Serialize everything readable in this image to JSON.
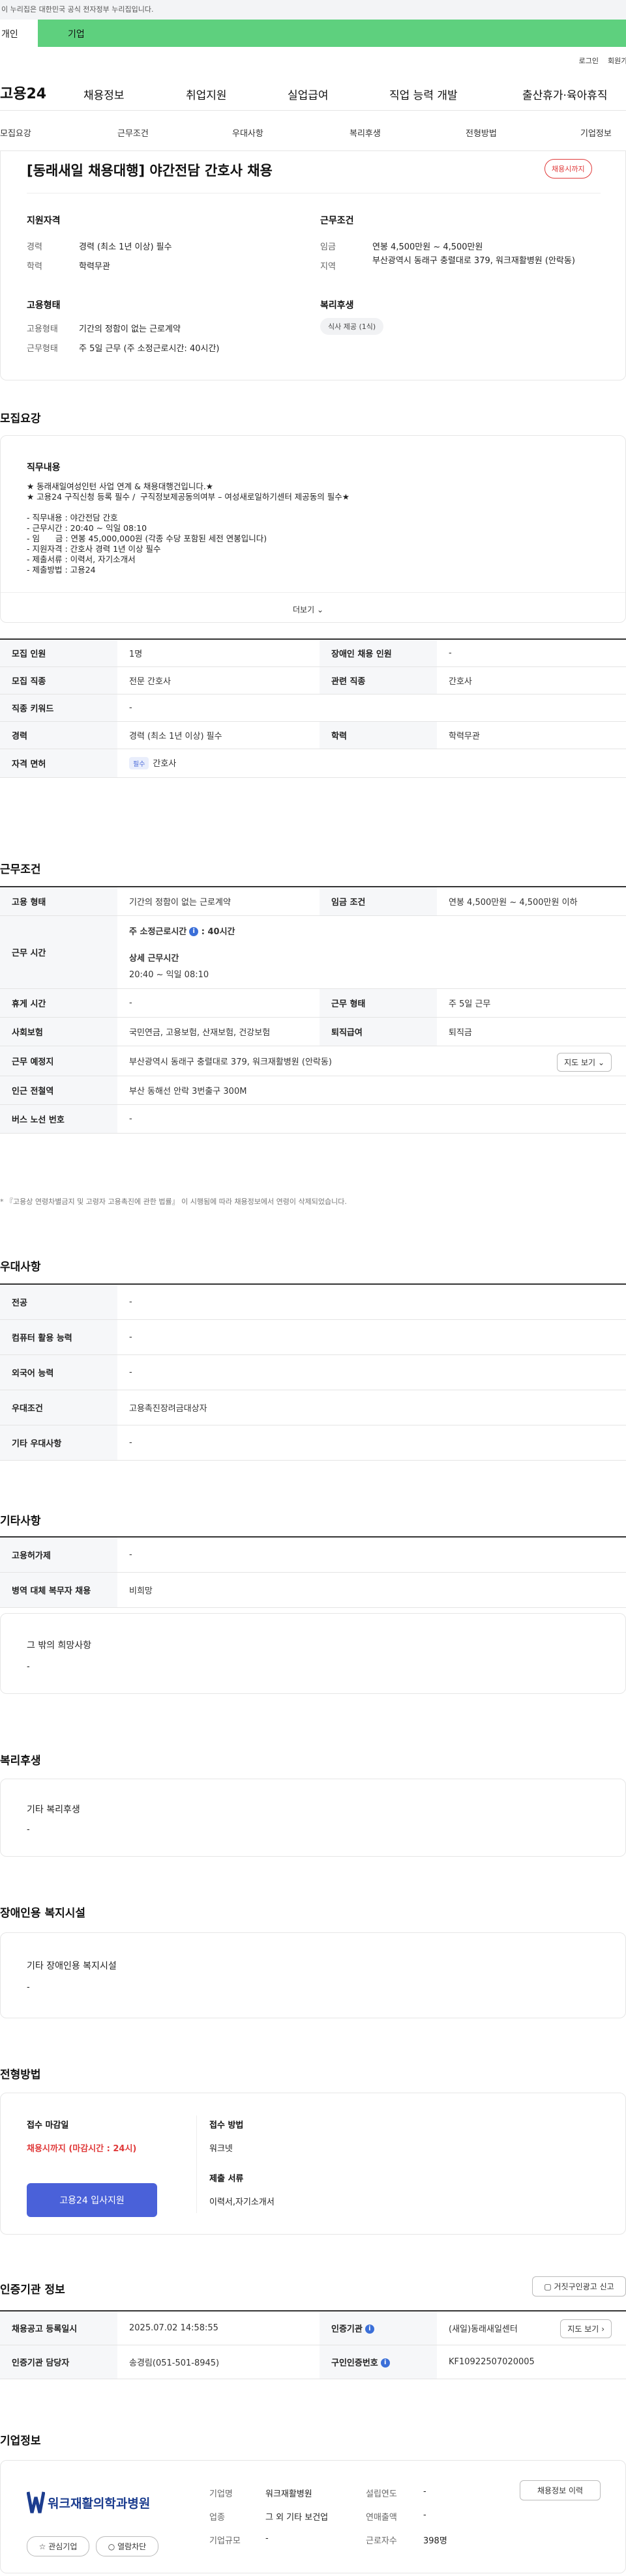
{
  "gov_banner": "이 누리집은 대한민국 공식 전자정부 누리집입니다.",
  "tabs": {
    "person": "개인",
    "business": "기업"
  },
  "util": {
    "login": "로그인",
    "join": "회원가입"
  },
  "logo": "고용24",
  "gnb": [
    "채용정보",
    "취업지원",
    "실업급여",
    "직업 능력 개발",
    "출산휴가·육아휴직"
  ],
  "subnav": [
    "모집요강",
    "근무조건",
    "우대사항",
    "복리후생",
    "전형방법",
    "기업정보"
  ],
  "summary": {
    "title": "[동래새일 채용대행] 야간전담 간호사 채용",
    "badge": "채용시까지",
    "qual_h": "지원자격",
    "career_l": "경력",
    "career_v": "경력 (최소 1년 이상) 필수",
    "edu_l": "학력",
    "edu_v": "학력무관",
    "emp_h": "고용형태",
    "type_l": "고용형태",
    "type_v": "기간의 정함이 없는 근로계약",
    "work_l": "근무형태",
    "work_v": "주 5일 근무 (주 소정근로시간: 40시간)",
    "cond_h": "근무조건",
    "wage_l": "임금",
    "wage_v": "연봉 4,500만원 ~ 4,500만원",
    "region_l": "지역",
    "region_v": "부산광역시 동래구 충렬대로 379, 워크재활병원 (안락동)",
    "welfare_h": "복리후생",
    "welfare_tag": "식사 제공 (1식)"
  },
  "recruit": {
    "heading": "모집요강",
    "duty_h": "직무내용",
    "lines": [
      "★ 동래새일여성인턴 사업 연계 & 채용대행건입니다.★",
      "★ 고용24 구직신청 등록 필수 /  구직정보제공동의여부 – 여성새로일하기센터 제공동의 필수★",
      "",
      "- 직무내용 : 야간전담 간호",
      "- 근무시간 : 20:40 ~ 익일 08:10",
      "- 임      금 : 연봉 45,000,000원 (각종 수당 포함된 세전 연봉입니다)",
      "- 지원자격 : 간호사 경력 1년 이상 필수",
      "- 제출서류 : 이력서, 자기소개서",
      "- 제출방법 : 고용24"
    ],
    "more": "더보기",
    "rows": [
      [
        "모집 인원",
        "1명",
        "장애인 채용 인원",
        "-"
      ],
      [
        "모집 직종",
        "전문 간호사",
        "관련 직종",
        "간호사"
      ],
      [
        "직종 키워드",
        "-",
        "",
        ""
      ],
      [
        "경력",
        "경력 (최소 1년 이상) 필수",
        "학력",
        "학력무관"
      ],
      [
        "자격 면허",
        "간호사",
        "",
        ""
      ]
    ],
    "pill": "필수"
  },
  "conditions": {
    "heading": "근무조건",
    "type_l": "고용 형태",
    "type_v": "기간의 정함이 없는 근로계약",
    "wage_l": "임금 조건",
    "wage_v": "연봉 4,500만원 ~ 4,500만원 이하",
    "time_l": "근무 시간",
    "time_main": "주 소정근로시간",
    "time_hours": ": 40시간",
    "time_detail_l": "상세 근무시간",
    "time_detail_v": "20:40 ~ 익일 08:10",
    "rest_l": "휴게 시간",
    "rest_v": "-",
    "form_l": "근무 형태",
    "form_v": "주 5일 근무",
    "ins_l": "사회보험",
    "ins_v": "국민연금, 고용보험, 산재보험, 건강보험",
    "sev_l": "퇴직급여",
    "sev_v": "퇴직금",
    "place_l": "근무 예정지",
    "place_v": "부산광역시 동래구 충렬대로 379, 워크재활병원 (안락동)",
    "map_btn": "지도 보기",
    "subway_l": "인근 전철역",
    "subway_v": "부산 동해선 안락 3번출구 300M",
    "bus_l": "버스 노선 번호",
    "bus_v": "-",
    "note": "* 『고용상 연령차별금지 및 고령자 고용촉진에 관한 법률』 이 시행됨에 따라 채용정보에서 연령이 삭제되었습니다."
  },
  "pref": {
    "heading": "우대사항",
    "rows": [
      [
        "전공",
        "-"
      ],
      [
        "컴퓨터 활용 능력",
        "-"
      ],
      [
        "외국어 능력",
        "-"
      ],
      [
        "우대조건",
        "고용촉진장려금대상자"
      ],
      [
        "기타 우대사항",
        "-"
      ]
    ]
  },
  "etc": {
    "heading": "기타사항",
    "rows": [
      [
        "고용허가제",
        "-"
      ],
      [
        "병역 대체 복무자 채용",
        "비희망"
      ]
    ],
    "box_h": "그 밖의 희망사항",
    "box_v": "-"
  },
  "welfare": {
    "heading": "복리후생",
    "box_h": "기타 복리후생",
    "box_v": "-"
  },
  "disabled": {
    "heading": "장애인용 복지시설",
    "box_h": "기타 장애인용 복지시설",
    "box_v": "-"
  },
  "selection": {
    "heading": "전형방법",
    "deadline_h": "접수 마감일",
    "deadline_v": "채용시까지 (마감시간 : 24시)",
    "method_h": "접수 방법",
    "method_v": "워크넷",
    "docs_h": "제출 서류",
    "docs_v": "이력서,자기소개서",
    "apply": "고용24 입사지원"
  },
  "cert": {
    "heading": "인증기관 정보",
    "report_btn": "거짓구인광고 신고",
    "reg_l": "채용공고 등록일시",
    "reg_v": "2025.07.02 14:58:55",
    "org_l": "인증기관",
    "org_v": "(새일)동래새일센터",
    "map_btn": "지도 보기",
    "staff_l": "인증기관 담당자",
    "staff_v": "송경림(051-501-8945)",
    "num_l": "구인인증번호",
    "num_v": "KF10922507020005"
  },
  "company": {
    "heading": "기업정보",
    "logo_text": "워크재활의학과병원",
    "fav": "관심기업",
    "block": "열람차단",
    "name_l": "기업명",
    "name_v": "워크재활병원",
    "year_l": "설립연도",
    "year_v": "-",
    "ind_l": "업종",
    "ind_v": "그 외 기타 보건업",
    "sales_l": "연매출액",
    "sales_v": "-",
    "size_l": "기업규모",
    "size_v": "-",
    "emp_l": "근로자수",
    "emp_v": "398명",
    "info_btn": "채용정보 이력"
  },
  "colors": {
    "brand_green": "#5ed07e",
    "accent_blue": "#4a61d9",
    "deadline_red": "#e03a3a"
  }
}
